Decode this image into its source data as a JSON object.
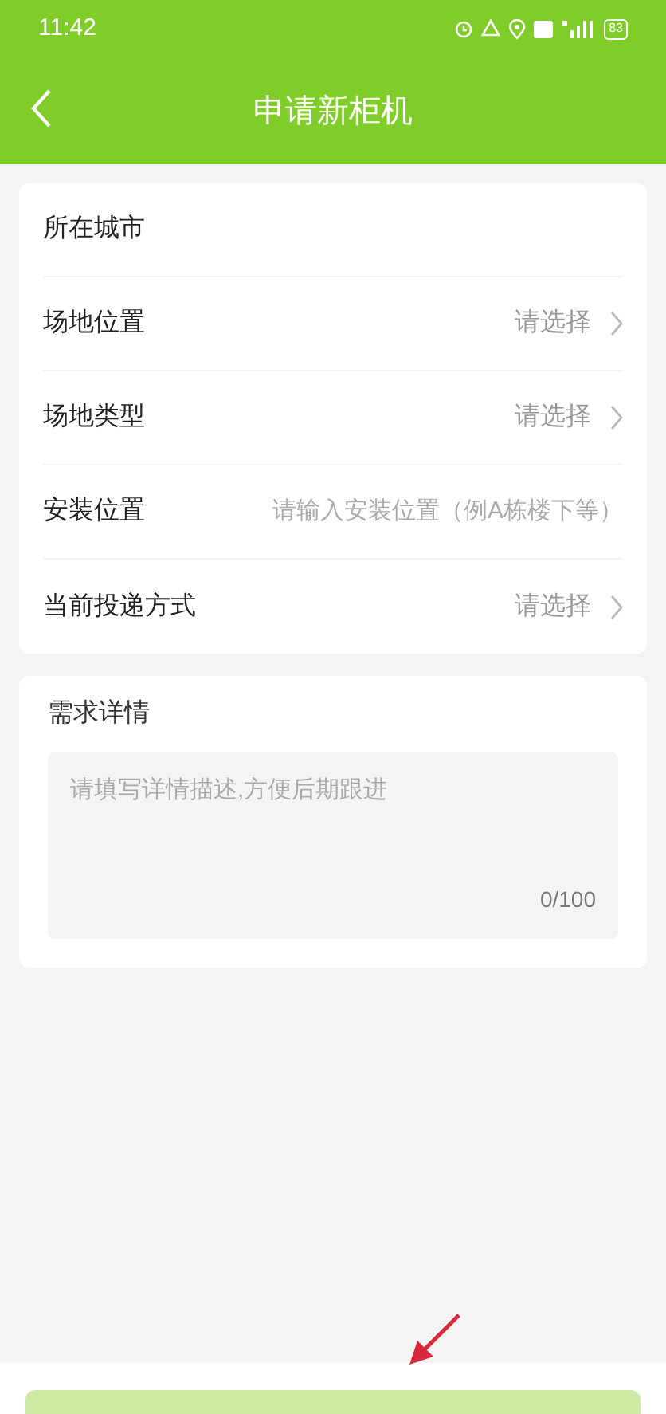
{
  "status_bar": {
    "time": "11:42",
    "battery": "83"
  },
  "header": {
    "title": "申请新柜机"
  },
  "form": [
    {
      "kind": "plain",
      "label": "所在城市"
    },
    {
      "kind": "select",
      "label": "场地位置",
      "value": "请选择"
    },
    {
      "kind": "select",
      "label": "场地类型",
      "value": "请选择"
    },
    {
      "kind": "input",
      "label": "安装位置",
      "placeholder": "请输入安装位置（例A栋楼下等）"
    },
    {
      "kind": "select",
      "label": "当前投递方式",
      "value": "请选择"
    }
  ],
  "details": {
    "label": "需求详情",
    "placeholder": "请填写详情描述,方便后期跟进",
    "counter": "0/100"
  },
  "submit": {
    "disabled": true
  }
}
